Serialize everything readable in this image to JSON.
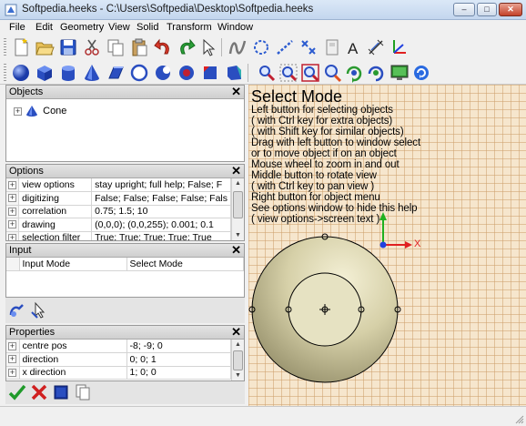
{
  "window": {
    "title": "Softpedia.heeks - C:\\Users\\Softpedia\\Desktop\\Softpedia.heeks",
    "minimize": "–",
    "maximize": "□",
    "close": "✕"
  },
  "menu": [
    "File",
    "Edit",
    "Geometry",
    "View",
    "Solid",
    "Transform",
    "Window"
  ],
  "toolbar_icons": {
    "row1": [
      "new-file-icon",
      "open-folder-icon",
      "save-icon",
      "cut-icon",
      "copy-icon",
      "paste-icon",
      "undo-icon",
      "redo-icon",
      "select-arrow-icon",
      "spline-icon",
      "circles-icon",
      "line-icon",
      "point-icon",
      "file-icon",
      "text-icon",
      "dimension-icon",
      "coordinate-system-icon"
    ],
    "row2": [
      "sphere-icon",
      "cube-icon",
      "cylinder-icon",
      "cone-icon",
      "extrude-icon",
      "fuse-icon",
      "cut-solid-icon",
      "common-icon",
      "chamfer-icon",
      "fillet-icon",
      "zoom-icon",
      "zoom-window-icon",
      "fit-view-icon",
      "magnify-icon",
      "rotate-view-icon",
      "pan-view-icon",
      "full-screen-icon",
      "redraw-icon"
    ]
  },
  "objects_panel": {
    "title": "Objects",
    "close": "✕",
    "tree": [
      {
        "expander": "+",
        "label": "Cone"
      }
    ]
  },
  "options_panel": {
    "title": "Options",
    "close": "✕",
    "rows": [
      {
        "expander": "+",
        "name": "view options",
        "value": "stay upright; full help; False; F"
      },
      {
        "expander": "+",
        "name": "digitizing",
        "value": "False; False; False; False; Fals"
      },
      {
        "expander": "+",
        "name": "correlation",
        "value": "0.75; 1.5; 10"
      },
      {
        "expander": "+",
        "name": "drawing",
        "value": "(0,0,0); (0,0,255); 0.001; 0.1"
      },
      {
        "expander": "+",
        "name": "selection filter",
        "value": "True; True; True; True; True"
      }
    ]
  },
  "input_panel": {
    "title": "Input",
    "close": "✕",
    "rows": [
      {
        "name": "Input Mode",
        "value": "Select Mode"
      }
    ]
  },
  "properties_panel": {
    "title": "Properties",
    "close": "✕",
    "rows": [
      {
        "expander": "+",
        "name": "centre pos",
        "value": "-8; -9; 0"
      },
      {
        "expander": "+",
        "name": "direction",
        "value": "0; 0; 1"
      },
      {
        "expander": "+",
        "name": "x direction",
        "value": "1; 0; 0"
      }
    ]
  },
  "graphics": {
    "help_title": "Select Mode",
    "help_lines": [
      "Left button for selecting objects",
      "( with Ctrl key for extra objects)",
      "( with Shift key for similar objects)",
      "Drag with left button to window select",
      "or to move object if on an object",
      "Mouse wheel to zoom in and out",
      "Middle button to rotate view",
      "( with Ctrl key to pan view )",
      "Right button for object menu",
      "See options window to hide this help",
      "( view options->screen text )"
    ],
    "axis_x_label": "X",
    "colors": {
      "background": "#f6e6cd",
      "grid": "#cda06e",
      "axis_x": "#e02020",
      "axis_y": "#20b020",
      "axis_z": "#2040e0"
    }
  }
}
